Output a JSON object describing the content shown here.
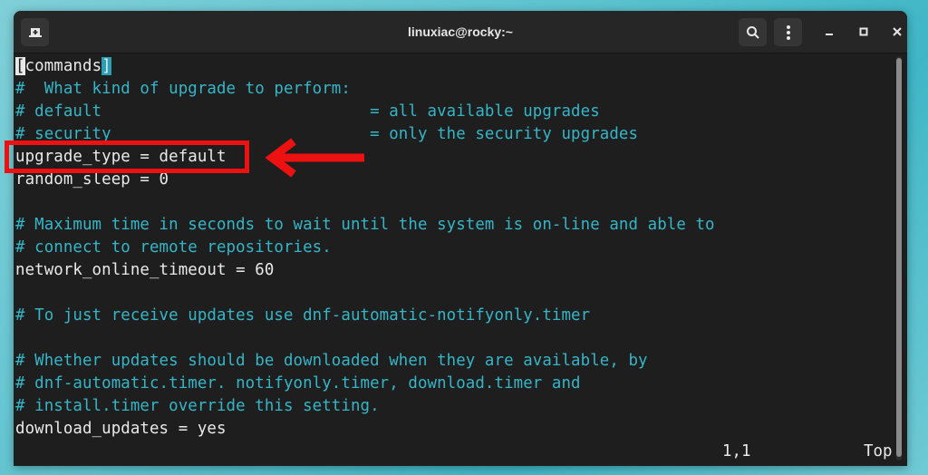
{
  "window": {
    "title": "linuxiac@rocky:~",
    "buttons": {
      "new_tab_icon": "new-tab-icon",
      "search_icon": "search-icon",
      "menu_icon": "kebab-menu-icon",
      "minimize_label": "–",
      "maximize_label": "□",
      "close_label": "✕"
    }
  },
  "editor": {
    "lines": [
      {
        "text": "[commands]",
        "type": "section"
      },
      {
        "text": "#  What kind of upgrade to perform:",
        "type": "comment"
      },
      {
        "text": "# default                            = all available upgrades",
        "type": "comment"
      },
      {
        "text": "# security                           = only the security upgrades",
        "type": "comment"
      },
      {
        "text": "upgrade_type = default",
        "type": "setting"
      },
      {
        "text": "random_sleep = 0",
        "type": "setting"
      },
      {
        "text": "",
        "type": "blank"
      },
      {
        "text": "# Maximum time in seconds to wait until the system is on-line and able to",
        "type": "comment"
      },
      {
        "text": "# connect to remote repositories.",
        "type": "comment"
      },
      {
        "text": "network_online_timeout = 60",
        "type": "setting"
      },
      {
        "text": "",
        "type": "blank"
      },
      {
        "text": "# To just receive updates use dnf-automatic-notifyonly.timer",
        "type": "comment"
      },
      {
        "text": "",
        "type": "blank"
      },
      {
        "text": "# Whether updates should be downloaded when they are available, by",
        "type": "comment"
      },
      {
        "text": "# dnf-automatic.timer. notifyonly.timer, download.timer and",
        "type": "comment"
      },
      {
        "text": "# install.timer override this setting.",
        "type": "comment"
      },
      {
        "text": "download_updates = yes",
        "type": "setting"
      }
    ],
    "section_open": "[",
    "section_name": "commands",
    "section_close": "]",
    "status_position": "1,1",
    "status_scroll": "Top"
  },
  "annotation": {
    "highlighted_line": "upgrade_type = default",
    "color": "#ee1111"
  }
}
